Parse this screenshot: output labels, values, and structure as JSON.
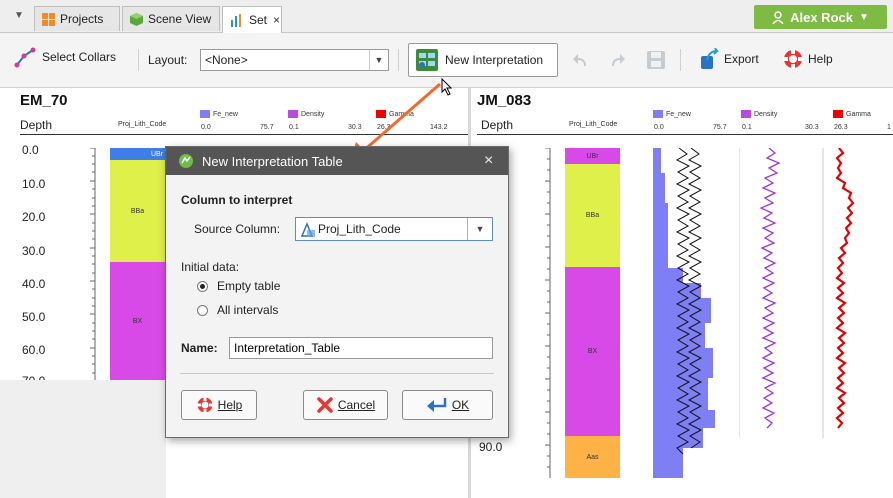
{
  "tabs": [
    {
      "label": "Projects"
    },
    {
      "label": "Scene View"
    },
    {
      "label": "Set",
      "close": "×"
    }
  ],
  "user": {
    "name": "Alex Rock"
  },
  "toolbar": {
    "select_collars": "Select Collars",
    "layout_label": "Layout:",
    "layout_value": "<None>",
    "new_interpretation": "New Interpretation",
    "export": "Export",
    "help": "Help"
  },
  "panels": [
    {
      "title": "EM_70",
      "depth_label": "Depth",
      "column_header": "Proj_Lith_Code",
      "legend": [
        {
          "name": "Fe_new",
          "color": "#7f7ff5",
          "min": "0.0",
          "max": "75.7"
        },
        {
          "name": "Density",
          "color": "#b84ae0",
          "min": "0.1",
          "max": "30.3"
        },
        {
          "name": "Gamma",
          "color": "#f00000",
          "min": "26.3",
          "max": "143.2"
        }
      ],
      "depth_ticks": [
        "0.0",
        "10.0",
        "20.0",
        "30.0",
        "40.0",
        "50.0",
        "60.0",
        "70.0"
      ],
      "units": [
        {
          "code": "UBr",
          "color": "#3f7ee6"
        },
        {
          "code": "BBa",
          "color": "#dff04a"
        },
        {
          "code": "BX",
          "color": "#d84ae8"
        }
      ]
    },
    {
      "title": "JM_083",
      "depth_label": "Depth",
      "column_header": "Proj_Lith_Code",
      "legend": [
        {
          "name": "Fe_new",
          "color": "#7f7ff5",
          "min": "0.0",
          "max": "75.7"
        },
        {
          "name": "Density",
          "color": "#b84ae0",
          "min": "0.1",
          "max": "30.3"
        },
        {
          "name": "Gamma",
          "color": "#f00000",
          "min": "26.3",
          "max": "1"
        }
      ],
      "depth_ticks": [
        "90.0"
      ],
      "units": [
        {
          "code": "UBr",
          "color": "#d84ae8"
        },
        {
          "code": "BBa",
          "color": "#dff04a"
        },
        {
          "code": "BX",
          "color": "#d84ae8"
        },
        {
          "code": "Aas",
          "color": "#ffb347"
        }
      ]
    }
  ],
  "dialog": {
    "title": "New Interpretation Table",
    "close": "×",
    "section_heading": "Column to interpret",
    "source_label": "Source Column:",
    "source_value": "Proj_Lith_Code",
    "initial_data_label": "Initial data:",
    "options": [
      {
        "label": "Empty table",
        "checked": true
      },
      {
        "label": "All intervals",
        "checked": false
      }
    ],
    "name_label": "Name:",
    "name_value": "Interpretation_Table",
    "buttons": {
      "help": "Help",
      "cancel": "Cancel",
      "ok": "OK"
    }
  },
  "colors": {
    "accent_green": "#7dbb42",
    "dialog_titlebar": "#555555",
    "arrow": "#f06a2a"
  }
}
